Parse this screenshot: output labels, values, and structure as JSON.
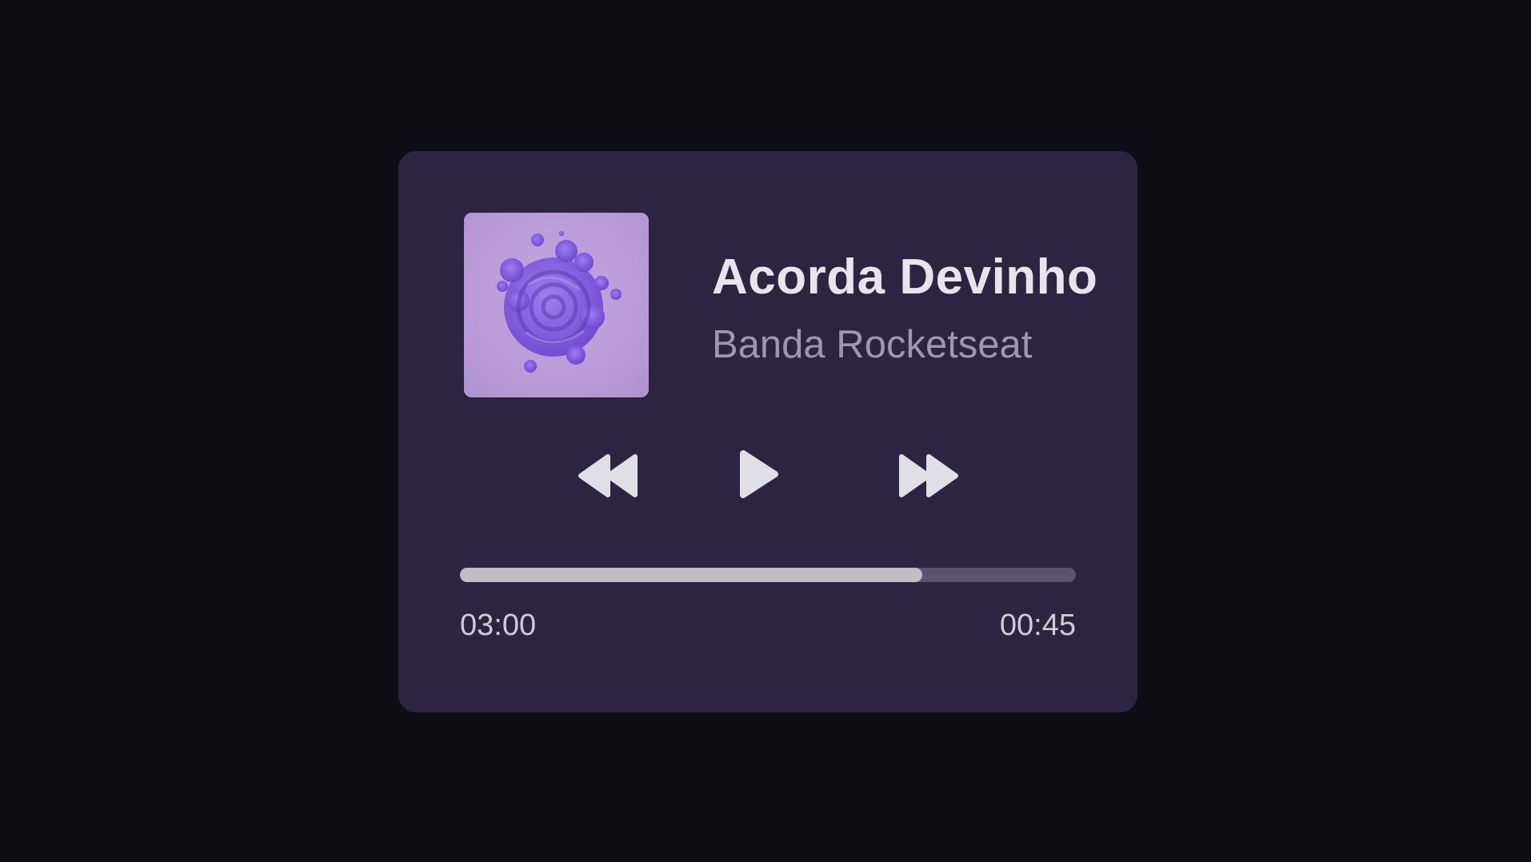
{
  "player": {
    "title": "Acorda Devinho",
    "artist": "Banda Rocketseat",
    "cover_icon": "abstract-purple-swirl-album-art",
    "controls": {
      "prev_icon": "rewind-icon",
      "play_icon": "play-icon",
      "next_icon": "fast-forward-icon"
    },
    "progress": {
      "fraction": 0.75,
      "time_left": "03:00",
      "time_right": "00:45"
    },
    "colors": {
      "background": "#0f0d14",
      "card": "#2d2442",
      "cover": "#b69ad6",
      "title": "#e7e4ec",
      "artist": "#9f98ad",
      "track": "#5b5470",
      "fill": "#bfbcc6"
    }
  }
}
